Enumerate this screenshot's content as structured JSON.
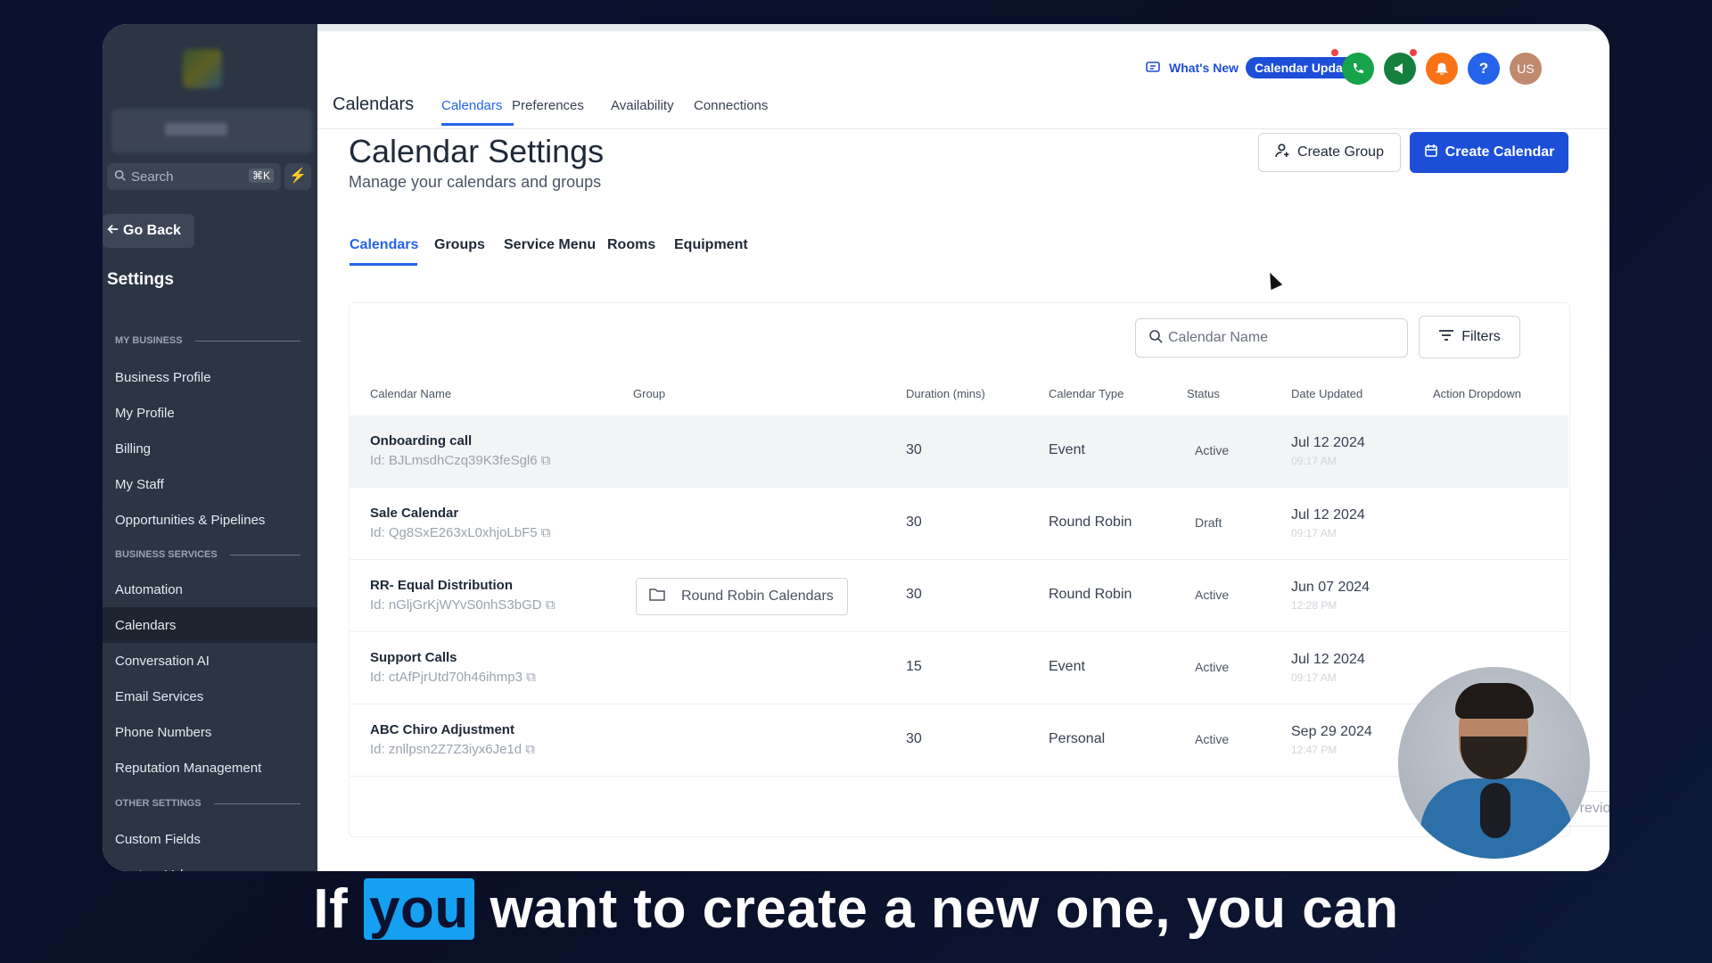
{
  "sidebar": {
    "search_placeholder": "Search",
    "search_shortcut": "⌘K",
    "go_back": "Go Back",
    "title": "Settings",
    "sections": {
      "my_business": "MY BUSINESS",
      "business_services": "BUSINESS SERVICES",
      "other_settings": "OTHER SETTINGS"
    },
    "items": [
      {
        "label": "Business Profile"
      },
      {
        "label": "My Profile"
      },
      {
        "label": "Billing"
      },
      {
        "label": "My Staff"
      },
      {
        "label": "Opportunities & Pipelines"
      },
      {
        "label": "Automation"
      },
      {
        "label": "Calendars",
        "active": true
      },
      {
        "label": "Conversation AI"
      },
      {
        "label": "Email Services"
      },
      {
        "label": "Phone Numbers"
      },
      {
        "label": "Reputation Management"
      },
      {
        "label": "Custom Fields"
      },
      {
        "label": "Custom Values"
      }
    ]
  },
  "topnav": {
    "title": "Calendars",
    "tabs": [
      "Calendars",
      "Preferences",
      "Availability",
      "Connections"
    ],
    "active_tab": "Calendars",
    "whats_new": "What's New",
    "calendar_updates": "Calendar Updates",
    "avatar_initials": "US",
    "help": "?"
  },
  "page": {
    "title": "Calendar Settings",
    "subtitle": "Manage your calendars and groups",
    "create_group": "Create Group",
    "create_calendar": "Create Calendar",
    "subtabs": [
      "Calendars",
      "Groups",
      "Service Menu",
      "Rooms",
      "Equipment"
    ],
    "active_subtab": "Calendars"
  },
  "table": {
    "search_placeholder": "Calendar Name",
    "filters_label": "Filters",
    "columns": [
      "Calendar Name",
      "Group",
      "Duration (mins)",
      "Calendar Type",
      "Status",
      "Date Updated",
      "Action Dropdown"
    ],
    "rows": [
      {
        "name": "Onboarding call",
        "id": "Id: BJLmsdhCzq39K3feSgl6",
        "group": "",
        "duration": "30",
        "type": "Event",
        "status": "Active",
        "date": "Jul 12 2024",
        "time": "09:17 AM"
      },
      {
        "name": "Sale Calendar",
        "id": "Id: Qg8SxE263xL0xhjoLbF5",
        "group": "",
        "duration": "30",
        "type": "Round Robin",
        "status": "Draft",
        "date": "Jul 12 2024",
        "time": "09:17 AM"
      },
      {
        "name": "RR- Equal Distribution",
        "id": "Id: nGljGrKjWYvS0nhS3bGD",
        "group": "Round Robin Calendars",
        "duration": "30",
        "type": "Round Robin",
        "status": "Active",
        "date": "Jun 07 2024",
        "time": "12:28 PM"
      },
      {
        "name": "Support Calls",
        "id": "Id: ctAfPjrUtd70h46ihmp3",
        "group": "",
        "duration": "15",
        "type": "Event",
        "status": "Active",
        "date": "Jul 12 2024",
        "time": "09:17 AM"
      },
      {
        "name": "ABC Chiro Adjustment",
        "id": "Id: znllpsn2Z7Z3iyx6Je1d",
        "group": "",
        "duration": "30",
        "type": "Personal",
        "status": "Active",
        "date": "Sep 29 2024",
        "time": "12:47 PM"
      }
    ],
    "previous_label": "Previous"
  },
  "caption": {
    "before": "If",
    "highlight": "you",
    "after": "want to create a new one, you can"
  },
  "colors": {
    "accent": "#1d4ed8",
    "sidebar_bg": "#2b3544",
    "caption_highlight": "#16a0f2"
  }
}
